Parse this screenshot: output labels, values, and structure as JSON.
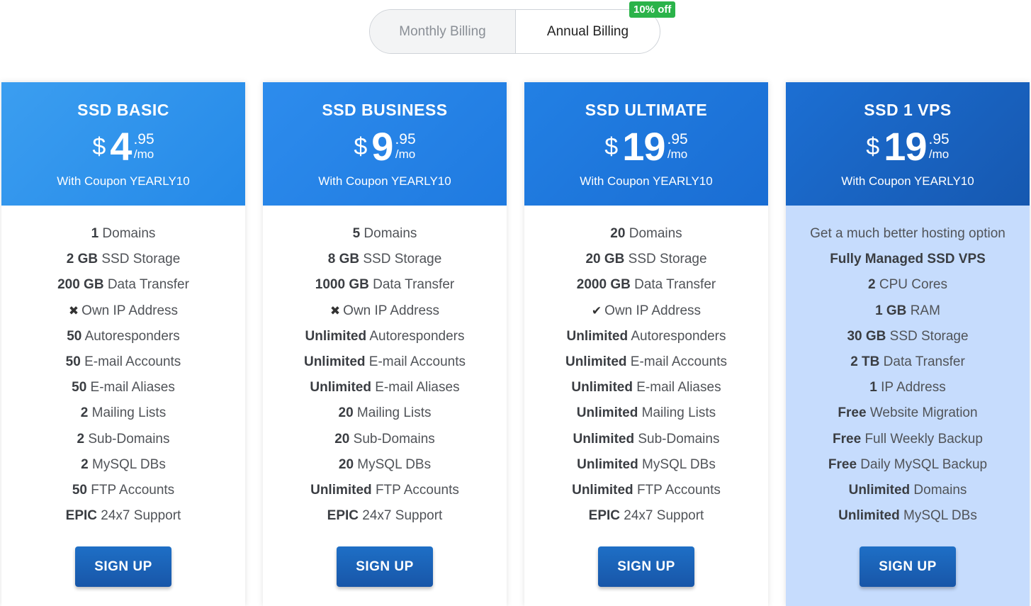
{
  "billing": {
    "monthly_label": "Monthly Billing",
    "annual_label": "Annual Billing",
    "discount_badge": "10% off",
    "selected": "Annual Billing"
  },
  "plans": [
    {
      "name": "SSD BASIC",
      "currency": "$",
      "amount": "4",
      "cents": ".95",
      "period": "/mo",
      "coupon": "With Coupon YEARLY10",
      "features": [
        {
          "bold": "1",
          "text": " Domains"
        },
        {
          "bold": "2 GB",
          "text": " SSD Storage"
        },
        {
          "bold": "200 GB",
          "text": " Data Transfer"
        },
        {
          "icon": "✖",
          "icon_name": "x-icon",
          "bold": "",
          "text": "Own IP Address"
        },
        {
          "bold": "50",
          "text": " Autoresponders"
        },
        {
          "bold": "50",
          "text": " E-mail Accounts"
        },
        {
          "bold": "50",
          "text": " E-mail Aliases"
        },
        {
          "bold": "2",
          "text": " Mailing Lists"
        },
        {
          "bold": "2",
          "text": " Sub-Domains"
        },
        {
          "bold": "2",
          "text": " MySQL DBs"
        },
        {
          "bold": "50",
          "text": " FTP Accounts"
        },
        {
          "bold": "EPIC",
          "text": " 24x7 Support"
        }
      ],
      "signup_label": "SIGN UP"
    },
    {
      "name": "SSD BUSINESS",
      "currency": "$",
      "amount": "9",
      "cents": ".95",
      "period": "/mo",
      "coupon": "With Coupon YEARLY10",
      "features": [
        {
          "bold": "5",
          "text": " Domains"
        },
        {
          "bold": "8 GB",
          "text": " SSD Storage"
        },
        {
          "bold": "1000 GB",
          "text": " Data Transfer"
        },
        {
          "icon": "✖",
          "icon_name": "x-icon",
          "bold": "",
          "text": "Own IP Address"
        },
        {
          "bold": "Unlimited",
          "text": " Autoresponders"
        },
        {
          "bold": "Unlimited",
          "text": " E-mail Accounts"
        },
        {
          "bold": "Unlimited",
          "text": " E-mail Aliases"
        },
        {
          "bold": "20",
          "text": " Mailing Lists"
        },
        {
          "bold": "20",
          "text": " Sub-Domains"
        },
        {
          "bold": "20",
          "text": " MySQL DBs"
        },
        {
          "bold": "Unlimited",
          "text": " FTP Accounts"
        },
        {
          "bold": "EPIC",
          "text": " 24x7 Support"
        }
      ],
      "signup_label": "SIGN UP"
    },
    {
      "name": "SSD ULTIMATE",
      "currency": "$",
      "amount": "19",
      "cents": ".95",
      "period": "/mo",
      "coupon": "With Coupon YEARLY10",
      "features": [
        {
          "bold": "20",
          "text": " Domains"
        },
        {
          "bold": "20 GB",
          "text": " SSD Storage"
        },
        {
          "bold": "2000 GB",
          "text": " Data Transfer"
        },
        {
          "icon": "✔",
          "icon_name": "check-icon",
          "bold": "",
          "text": "Own IP Address"
        },
        {
          "bold": "Unlimited",
          "text": " Autoresponders"
        },
        {
          "bold": "Unlimited",
          "text": " E-mail Accounts"
        },
        {
          "bold": "Unlimited",
          "text": " E-mail Aliases"
        },
        {
          "bold": "Unlimited",
          "text": " Mailing Lists"
        },
        {
          "bold": "Unlimited",
          "text": " Sub-Domains"
        },
        {
          "bold": "Unlimited",
          "text": " MySQL DBs"
        },
        {
          "bold": "Unlimited",
          "text": " FTP Accounts"
        },
        {
          "bold": "EPIC",
          "text": " 24x7 Support"
        }
      ],
      "signup_label": "SIGN UP"
    },
    {
      "name": "SSD 1 VPS",
      "currency": "$",
      "amount": "19",
      "cents": ".95",
      "period": "/mo",
      "coupon": "With Coupon YEARLY10",
      "features": [
        {
          "bold": "",
          "text": "Get a much better hosting option"
        },
        {
          "bold": "Fully Managed SSD VPS",
          "text": ""
        },
        {
          "bold": "2",
          "text": " CPU Cores"
        },
        {
          "bold": "1 GB",
          "text": " RAM"
        },
        {
          "bold": "30 GB",
          "text": " SSD Storage"
        },
        {
          "bold": "2 TB",
          "text": " Data Transfer"
        },
        {
          "bold": "1",
          "text": " IP Address"
        },
        {
          "bold": "Free",
          "text": " Website Migration"
        },
        {
          "bold": "Free",
          "text": " Full Weekly Backup"
        },
        {
          "bold": "Free",
          "text": " Daily MySQL Backup"
        },
        {
          "bold": "Unlimited",
          "text": " Domains"
        },
        {
          "bold": "Unlimited",
          "text": " MySQL DBs"
        }
      ],
      "signup_label": "SIGN UP"
    }
  ]
}
